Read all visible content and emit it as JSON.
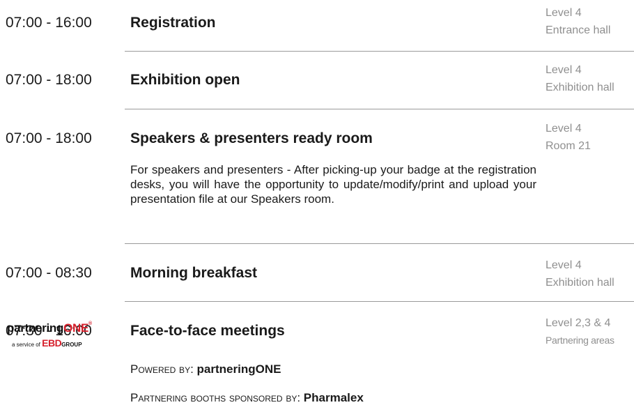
{
  "sessions": [
    {
      "time": "07:00 - 16:00",
      "title": "Registration",
      "level": "Level 4",
      "room": "Entrance hall"
    },
    {
      "time": "07:00 - 18:00",
      "title": "Exhibition open",
      "level": "Level 4",
      "room": "Exhibition hall"
    },
    {
      "time": "07:00 - 18:00",
      "title": "Speakers & presenters ready room",
      "level": "Level 4",
      "room": "Room 21",
      "description": "For speakers and presenters - After picking-up your badge at the registration desks, you will have the opportunity to update/modify/print and upload your presentation file at our Speakers room."
    },
    {
      "time": "07:00 - 08:30",
      "title": "Morning breakfast",
      "level": "Level 4",
      "room": "Exhibition hall"
    },
    {
      "time": "07:30 - 16:00",
      "title": "Face-to-face meetings",
      "level": "Level 2,3 & 4",
      "room": "Partnering areas"
    }
  ],
  "partnering": {
    "powered_label": "Powered by",
    "powered_value": "partneringONE",
    "booths_label": "Partnering booths sponsored by",
    "booths_value": "Pharmalex"
  },
  "logo": {
    "brand_main": "partnering",
    "brand_accent": "ONE",
    "brand_mark": "®",
    "service_text": "a service of",
    "ebd": "EBD",
    "group": "GROUP"
  },
  "colors": {
    "text": "#1a1a1a",
    "location_text": "#8f8f8f",
    "divider": "#9a9a9a",
    "logo_accent": "#d6202c"
  }
}
